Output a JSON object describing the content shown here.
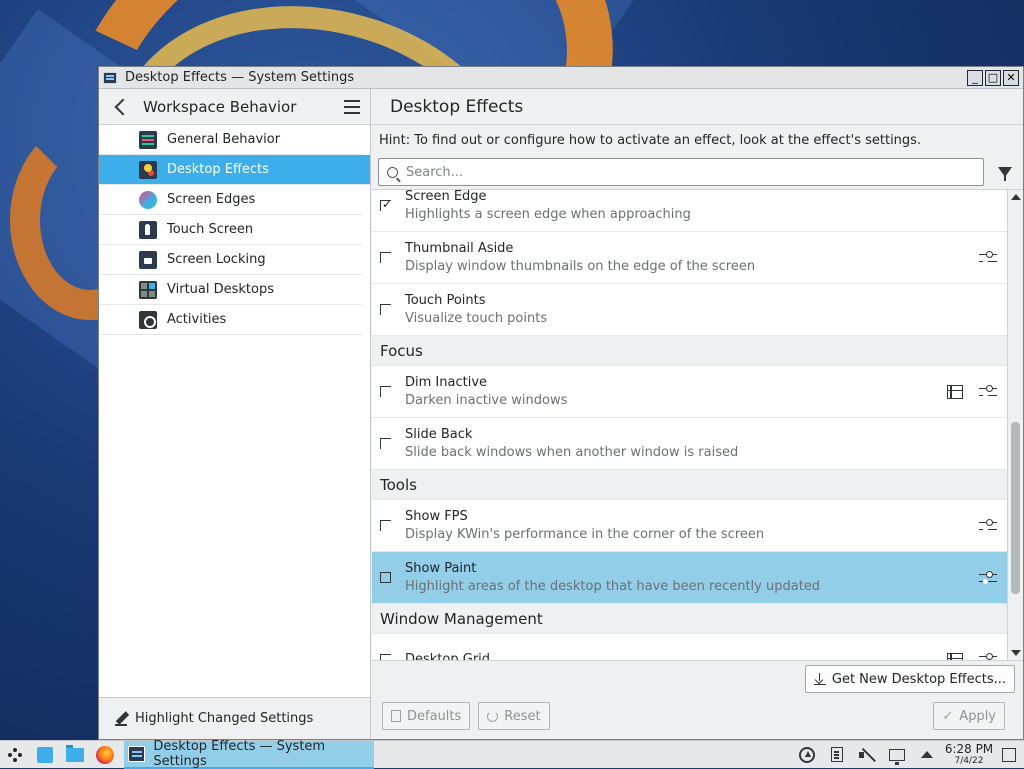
{
  "window": {
    "title": "Desktop Effects — System Settings",
    "controls": {
      "minimize": "_",
      "maximize": "□",
      "close": "✕"
    }
  },
  "sidebar": {
    "header_title": "Workspace Behavior",
    "items": [
      {
        "label": "General Behavior",
        "icon": "general-behavior-icon",
        "selected": false
      },
      {
        "label": "Desktop Effects",
        "icon": "desktop-effects-icon",
        "selected": true
      },
      {
        "label": "Screen Edges",
        "icon": "screen-edges-icon",
        "selected": false
      },
      {
        "label": "Touch Screen",
        "icon": "touch-screen-icon",
        "selected": false
      },
      {
        "label": "Screen Locking",
        "icon": "screen-locking-icon",
        "selected": false
      },
      {
        "label": "Virtual Desktops",
        "icon": "virtual-desktops-icon",
        "selected": false
      },
      {
        "label": "Activities",
        "icon": "activities-icon",
        "selected": false
      }
    ],
    "footer_label": "Highlight Changed Settings"
  },
  "main": {
    "title": "Desktop Effects",
    "hint": "Hint: To find out or configure how to activate an effect, look at the effect's settings.",
    "search_placeholder": "Search...",
    "effects": [
      {
        "type": "effect",
        "name": "Screen Edge",
        "desc": "Highlights a screen edge when approaching",
        "checked": true,
        "video": false,
        "configure": false
      },
      {
        "type": "effect",
        "name": "Thumbnail Aside",
        "desc": "Display window thumbnails on the edge of the screen",
        "checked": false,
        "video": false,
        "configure": true
      },
      {
        "type": "effect",
        "name": "Touch Points",
        "desc": "Visualize touch points",
        "checked": false,
        "video": false,
        "configure": false
      },
      {
        "type": "section",
        "name": "Focus"
      },
      {
        "type": "effect",
        "name": "Dim Inactive",
        "desc": "Darken inactive windows",
        "checked": false,
        "video": true,
        "configure": true
      },
      {
        "type": "effect",
        "name": "Slide Back",
        "desc": "Slide back windows when another window is raised",
        "checked": false,
        "video": false,
        "configure": false
      },
      {
        "type": "section",
        "name": "Tools"
      },
      {
        "type": "effect",
        "name": "Show FPS",
        "desc": "Display KWin's performance in the corner of the screen",
        "checked": false,
        "video": false,
        "configure": true
      },
      {
        "type": "effect",
        "name": "Show Paint",
        "desc": "Highlight areas of the desktop that have been recently updated",
        "checked": false,
        "video": false,
        "configure": true,
        "highlighted": true
      },
      {
        "type": "section",
        "name": "Window Management"
      },
      {
        "type": "effect",
        "name": "Desktop Grid",
        "desc": "",
        "checked": false,
        "video": true,
        "configure": true
      }
    ],
    "get_new_label": "Get New Desktop Effects...",
    "defaults_label": "Defaults",
    "reset_label": "Reset",
    "apply_label": "Apply"
  },
  "taskbar": {
    "task_label": "Desktop Effects  — System Settings",
    "clock_time": "6:28 PM",
    "clock_date": "7/4/22"
  },
  "colors": {
    "accent": "#3daee9",
    "selection_light": "#93cee9",
    "window_bg": "#eff0f1"
  }
}
